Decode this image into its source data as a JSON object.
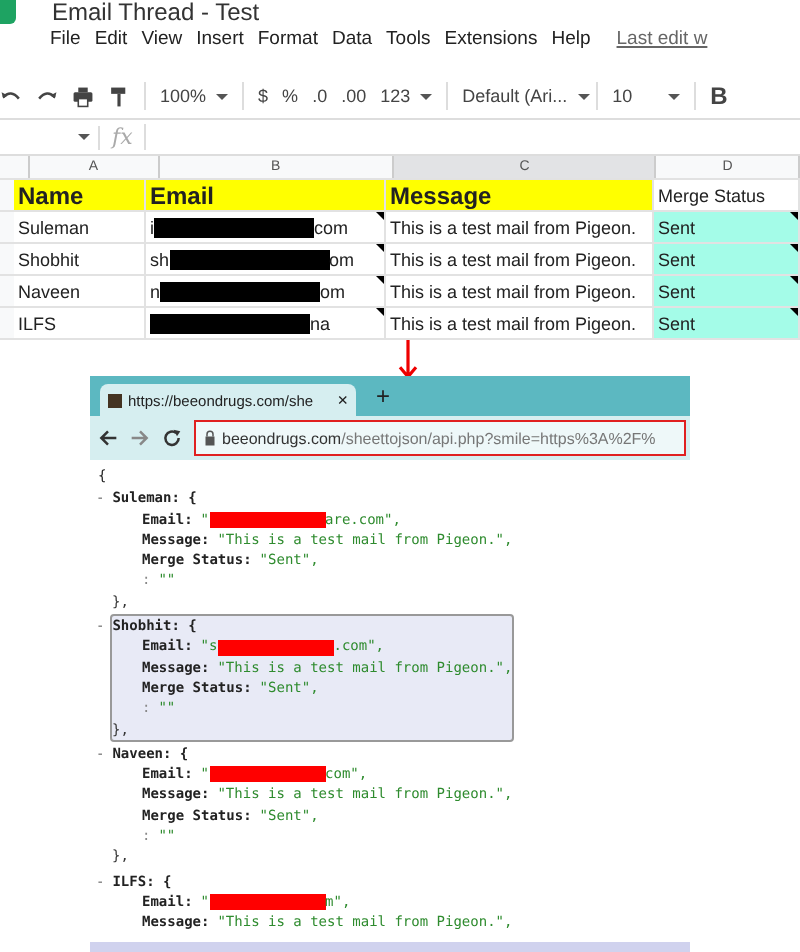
{
  "document": {
    "title": "Email Thread - Test"
  },
  "menu": [
    "File",
    "Edit",
    "View",
    "Insert",
    "Format",
    "Data",
    "Tools",
    "Extensions",
    "Help"
  ],
  "last_edit": "Last edit w",
  "toolbar": {
    "zoom": "100%",
    "currency": "$",
    "percent": "%",
    "decrease_decimals": ".0",
    "increase_decimals": ".00",
    "format": "123",
    "font": "Default (Ari...",
    "font_size": "10",
    "bold": "B"
  },
  "formula_bar": {
    "fx": "fx"
  },
  "columns": [
    "A",
    "B",
    "C",
    "D"
  ],
  "header_row": [
    {
      "text": "Name",
      "highlighted": true
    },
    {
      "text": "Email",
      "highlighted": true
    },
    {
      "text": "Message",
      "highlighted": true
    },
    {
      "text": "Merge Status",
      "highlighted": false
    }
  ],
  "rows": [
    {
      "name": "Suleman",
      "email_start": "i",
      "email_end": "com",
      "message": "This is a test mail from Pigeon.",
      "status": "Sent"
    },
    {
      "name": "Shobhit",
      "email_start": "sh",
      "email_end": "om",
      "message": "This is a test mail from Pigeon.",
      "status": "Sent"
    },
    {
      "name": "Naveen",
      "email_start": "n",
      "email_end": "om",
      "message": "This is a test mail from Pigeon.",
      "status": "Sent"
    },
    {
      "name": "ILFS",
      "email_start": "",
      "email_end": "na",
      "message": "This is a test mail from Pigeon.",
      "status": "Sent"
    }
  ],
  "browser": {
    "tab_title": "https://beeondrugs.com/she",
    "tab_close": "×",
    "new_tab": "+",
    "url_domain": "beeondrugs.com",
    "url_path": "/sheettojson/api.php?smile=https%3A%2F%"
  },
  "json_view": {
    "open": "{",
    "records": [
      {
        "toggle": "-",
        "title": "Suleman: {",
        "highlighted": false,
        "fields": [
          {
            "key": "Email:",
            "before": "\"",
            "redacted": true,
            "after": "are.com\","
          },
          {
            "key": "Message:",
            "before": "\"This is a test mail from Pigeon.\","
          },
          {
            "key": "Merge Status:",
            "before": "\"Sent\","
          },
          {
            "key": ":",
            "before": "\"\""
          }
        ],
        "close": "},"
      },
      {
        "toggle": "-",
        "title": "Shobhit: {",
        "highlighted": true,
        "fields": [
          {
            "key": "Email:",
            "before": "\"s",
            "redacted": true,
            "after": ".com\","
          },
          {
            "key": "Message:",
            "before": "\"This is a test mail from Pigeon.\","
          },
          {
            "key": "Merge Status:",
            "before": "\"Sent\","
          },
          {
            "key": ":",
            "before": "\"\""
          }
        ],
        "close": "},"
      },
      {
        "toggle": "-",
        "title": "Naveen: {",
        "highlighted": false,
        "fields": [
          {
            "key": "Email:",
            "before": "\"",
            "redacted": true,
            "after": "com\","
          },
          {
            "key": "Message:",
            "before": "\"This is a test mail from Pigeon.\","
          },
          {
            "key": "Merge Status:",
            "before": "\"Sent\","
          },
          {
            "key": ":",
            "before": "\"\""
          }
        ],
        "close": "},"
      },
      {
        "toggle": "-",
        "title": "ILFS: {",
        "highlighted": false,
        "fields": [
          {
            "key": "Email:",
            "before": "\"",
            "redacted": true,
            "after": "m\","
          },
          {
            "key": "Message:",
            "before": "\"This is a test mail from Pigeon.\","
          }
        ]
      }
    ]
  }
}
